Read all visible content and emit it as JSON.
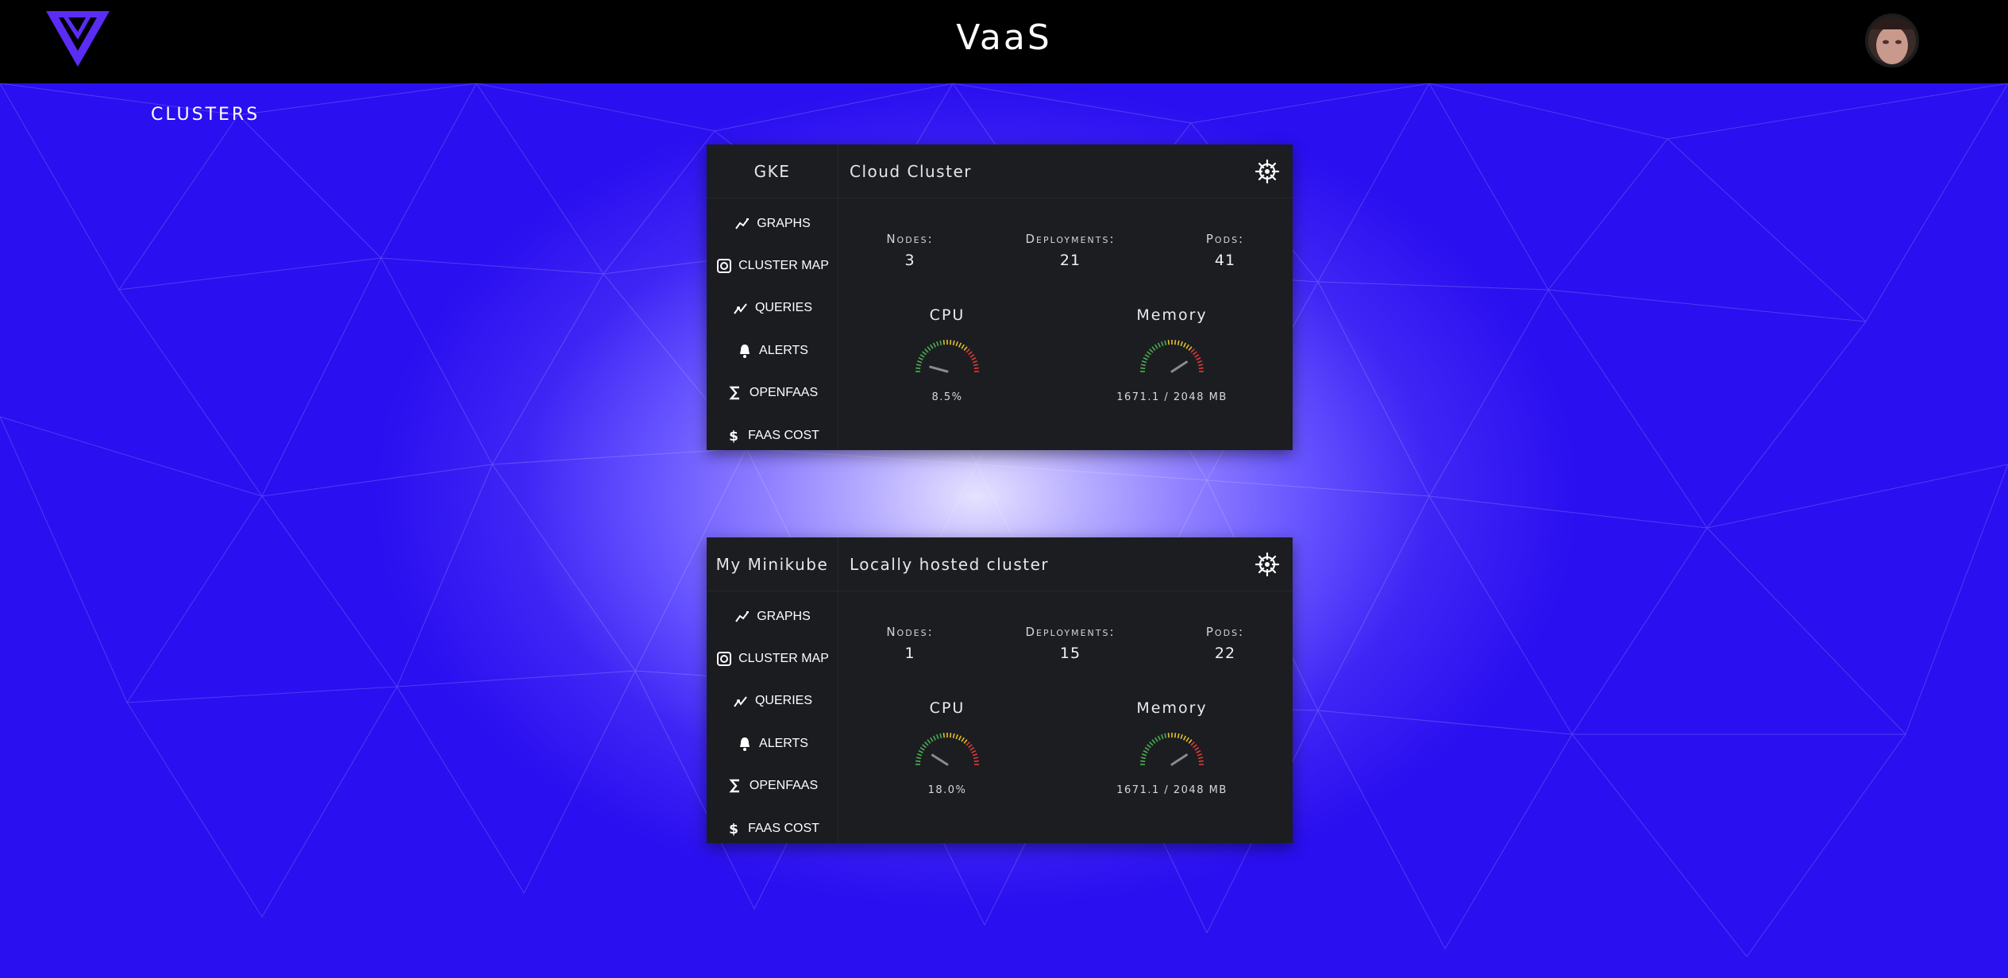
{
  "app": {
    "title": "VaaS"
  },
  "header": {
    "logo": "vaas-v-logo",
    "avatar": "user-avatar"
  },
  "section": {
    "label": "CLUSTERS"
  },
  "nav_labels": [
    "GRAPHS",
    "CLUSTER MAP",
    "QUERIES",
    "ALERTS",
    "OPENFAAS",
    "FAAS COST"
  ],
  "stat_labels": {
    "nodes": "Nodes:",
    "deployments": "Deployments:",
    "pods": "Pods:"
  },
  "gauge_labels": {
    "cpu": "CPU",
    "memory": "Memory"
  },
  "clusters": [
    {
      "name": "GKE",
      "description": "Cloud Cluster",
      "nodes": "3",
      "deployments": "21",
      "pods": "41",
      "cpu_text": "8.5%",
      "cpu_percent": 8.5,
      "memory_text": "1671.1 / 2048 MB",
      "memory_fraction": 0.816
    },
    {
      "name": "My Minikube",
      "description": "Locally hosted cluster",
      "nodes": "1",
      "deployments": "15",
      "pods": "22",
      "cpu_text": "18.0%",
      "cpu_percent": 18.0,
      "memory_text": "1671.1 / 2048 MB",
      "memory_fraction": 0.816
    }
  ],
  "colors": {
    "accent": "#5a2df5",
    "card_bg": "#1c1d21",
    "header_bg": "#000000",
    "gauge_low": "#4caf50",
    "gauge_mid": "#e6c229",
    "gauge_high": "#e53935"
  },
  "icons": {
    "graphs": "trend-line-icon",
    "cluster_map": "cluster-map-icon",
    "queries": "queries-chart-icon",
    "alerts": "bell-icon",
    "openfaas": "sigma-icon",
    "faas_cost": "dollar-icon",
    "cluster_settings": "kubernetes-wheel-icon"
  }
}
